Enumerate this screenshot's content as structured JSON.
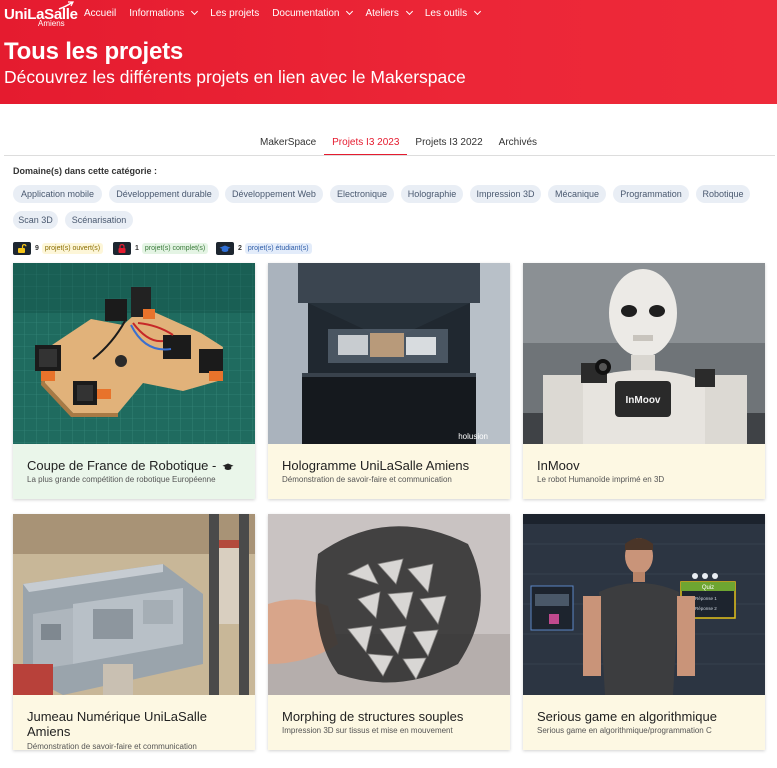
{
  "header": {
    "logo_main": "UniLaSalle",
    "logo_sub": "Amiens",
    "nav": [
      {
        "label": "Accueil",
        "dropdown": false
      },
      {
        "label": "Informations",
        "dropdown": true
      },
      {
        "label": "Les projets",
        "dropdown": false
      },
      {
        "label": "Documentation",
        "dropdown": true
      },
      {
        "label": "Ateliers",
        "dropdown": true
      },
      {
        "label": "Les outils",
        "dropdown": true
      }
    ],
    "title": "Tous les projets",
    "subtitle": "Découvrez les différents projets en lien avec le Makerspace"
  },
  "tabs": [
    {
      "label": "MakerSpace",
      "active": false
    },
    {
      "label": "Projets I3 2023",
      "active": true
    },
    {
      "label": "Projets I3 2022",
      "active": false
    },
    {
      "label": "Archivés",
      "active": false
    }
  ],
  "domains": {
    "label": "Domaine(s) dans cette catégorie :",
    "tags": [
      "Application mobile",
      "Développement durable",
      "Développement Web",
      "Electronique",
      "Holographie",
      "Impression 3D",
      "Mécanique",
      "Programmation",
      "Robotique",
      "Scan 3D",
      "Scénarisation"
    ]
  },
  "legend": [
    {
      "count": "9",
      "text": "projet(s) ouvert(s)",
      "icon": "unlock-icon",
      "color": "#f5c518",
      "bg": "#fdf6d8",
      "fg": "#8a6d00"
    },
    {
      "count": "1",
      "text": "projet(s) complet(s)",
      "icon": "lock-icon",
      "color": "#e51b2f",
      "bg": "#e4f4e4",
      "fg": "#3a7a3a"
    },
    {
      "count": "2",
      "text": "projet(s) étudiant(s)",
      "icon": "graduation-cap-icon",
      "color": "#2f6fd6",
      "bg": "#e3ecfa",
      "fg": "#2f5da8"
    }
  ],
  "cards": [
    {
      "title": "Coupe de France de Robotique -",
      "subtitle": "La plus grande compétition de robotique Européenne",
      "student": true,
      "status": "complete"
    },
    {
      "title": "Hologramme UniLaSalle Amiens",
      "subtitle": "Démonstration de savoir-faire et communication",
      "watermark": "holusion"
    },
    {
      "title": "InMoov",
      "subtitle": "Le robot Humanoïde imprimé en 3D",
      "chest_text": "InMoov"
    },
    {
      "title": "Jumeau Numérique UniLaSalle Amiens",
      "subtitle": "Démonstration de savoir-faire et communication"
    },
    {
      "title": "Morphing de structures souples",
      "subtitle": "Impression 3D sur tissus et mise en mouvement"
    },
    {
      "title": "Serious game en algorithmique",
      "subtitle": "Serious game en algorithmique/programmation C",
      "node_title": "Quiz",
      "node_rows": [
        "Réponse 1",
        "Réponse 2"
      ]
    }
  ],
  "colors": {
    "brand": "#e51b2f",
    "tag_bg": "#e9eef5",
    "card_open": "#fdf8e3",
    "card_complete": "#eaf6ea"
  }
}
